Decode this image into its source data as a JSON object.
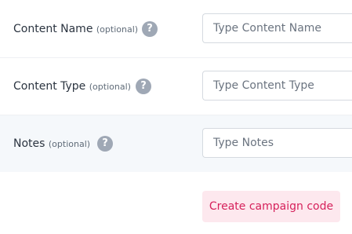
{
  "fields": [
    {
      "label": "Content Name",
      "optional_text": "(optional)",
      "help_icon": "question-mark-icon",
      "placeholder": "Type Content Name",
      "value": ""
    },
    {
      "label": "Content Type",
      "optional_text": "(optional)",
      "help_icon": "question-mark-icon",
      "placeholder": "Type Content Type",
      "value": ""
    },
    {
      "label": "Notes",
      "optional_text": "(optional)",
      "help_icon": "question-mark-icon",
      "placeholder": "Type Notes",
      "value": ""
    }
  ],
  "help_glyph": "?",
  "submit_label": "Create campaign code",
  "colors": {
    "accent_text": "#d6215b",
    "accent_bg": "#fde8ee",
    "help_icon_bg": "#9fa8b5",
    "highlight_row_bg": "#f5f8fb"
  }
}
